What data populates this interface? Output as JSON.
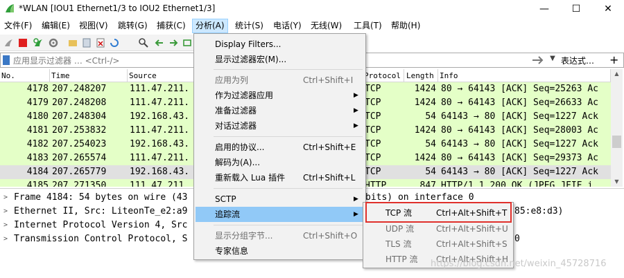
{
  "window": {
    "title": "*WLAN [IOU1 Ethernet1/3 to IOU2 Ethernet1/3]",
    "minimize": "—",
    "maximize": "☐",
    "close": "✕"
  },
  "menubar": [
    "文件(F)",
    "编辑(E)",
    "视图(V)",
    "跳转(G)",
    "捕获(C)",
    "分析(A)",
    "统计(S)",
    "电话(Y)",
    "无线(W)",
    "工具(T)",
    "帮助(H)"
  ],
  "filter": {
    "placeholder": "应用显示过滤器 … <Ctrl-/>",
    "expression_label": "表达式…",
    "add_label": "+",
    "dropdown": "▼"
  },
  "packet_list": {
    "columns": [
      "No.",
      "Time",
      "Source",
      "Protocol",
      "Length",
      "Info"
    ],
    "rows": [
      {
        "no": "4178",
        "time": "207.248207",
        "src": "111.47.211.",
        "proto": "TCP",
        "len": "1424",
        "info": "80 → 64143 [ACK] Seq=25263 Ac"
      },
      {
        "no": "4179",
        "time": "207.248208",
        "src": "111.47.211.",
        "proto": "TCP",
        "len": "1424",
        "info": "80 → 64143 [ACK] Seq=26633 Ac"
      },
      {
        "no": "4180",
        "time": "207.248304",
        "src": "192.168.43.",
        "proto": "TCP",
        "len": "54",
        "info": "64143 → 80 [ACK] Seq=1227 Ack"
      },
      {
        "no": "4181",
        "time": "207.253832",
        "src": "111.47.211.",
        "proto": "TCP",
        "len": "1424",
        "info": "80 → 64143 [ACK] Seq=28003 Ac"
      },
      {
        "no": "4182",
        "time": "207.254023",
        "src": "192.168.43.",
        "proto": "TCP",
        "len": "54",
        "info": "64143 → 80 [ACK] Seq=1227 Ack"
      },
      {
        "no": "4183",
        "time": "207.265574",
        "src": "111.47.211.",
        "proto": "TCP",
        "len": "1424",
        "info": "80 → 64143 [ACK] Seq=29373 Ac"
      },
      {
        "no": "4184",
        "time": "207.265779",
        "src": "192.168.43.",
        "proto": "TCP",
        "len": "54",
        "info": "64143 → 80 [ACK] Seq=1227 Ack"
      },
      {
        "no": "4185",
        "time": "207.271350",
        "src": "111.47.211.",
        "proto": "HTTP",
        "len": "847",
        "info": "HTTP/1.1 200 OK  (JPEG JFIF i"
      }
    ]
  },
  "details": [
    {
      "text": "Frame 4184: 54 bytes on wire (43",
      "tail": "bits) on interface 0"
    },
    {
      "text": "Ethernet II, Src: LiteonTe_e2:a9",
      "tail": "85:e8:d3)"
    },
    {
      "text": "Internet Protocol Version 4, Src",
      "tail": ""
    },
    {
      "text": "Transmission Control Protocol, S",
      "tail": "0"
    }
  ],
  "analyze_menu": {
    "items": [
      {
        "label": "Display Filters...",
        "shortcut": "",
        "arrow": false,
        "disabled": false
      },
      {
        "label": "显示过滤器宏(M)...",
        "shortcut": "",
        "arrow": false,
        "disabled": false
      },
      {
        "label": "应用为列",
        "shortcut": "Ctrl+Shift+I",
        "arrow": false,
        "disabled": true
      },
      {
        "label": "作为过滤器应用",
        "shortcut": "",
        "arrow": true,
        "disabled": false
      },
      {
        "label": "准备过滤器",
        "shortcut": "",
        "arrow": true,
        "disabled": false
      },
      {
        "label": "对话过滤器",
        "shortcut": "",
        "arrow": true,
        "disabled": false
      },
      {
        "label": "启用的协议...",
        "shortcut": "Ctrl+Shift+E",
        "arrow": false,
        "disabled": false
      },
      {
        "label": "解码为(A)...",
        "shortcut": "",
        "arrow": false,
        "disabled": false
      },
      {
        "label": "重新载入 Lua 插件",
        "shortcut": "Ctrl+Shift+L",
        "arrow": false,
        "disabled": false
      },
      {
        "label": "SCTP",
        "shortcut": "",
        "arrow": true,
        "disabled": false
      },
      {
        "label": "追踪流",
        "shortcut": "",
        "arrow": true,
        "disabled": false
      },
      {
        "label": "显示分组字节...",
        "shortcut": "Ctrl+Shift+O",
        "arrow": false,
        "disabled": true
      },
      {
        "label": "专家信息",
        "shortcut": "",
        "arrow": false,
        "disabled": false
      }
    ]
  },
  "follow_submenu": {
    "items": [
      {
        "label": "TCP 流",
        "shortcut": "Ctrl+Alt+Shift+T",
        "disabled": false
      },
      {
        "label": "UDP 流",
        "shortcut": "Ctrl+Alt+Shift+U",
        "disabled": true
      },
      {
        "label": "TLS 流",
        "shortcut": "Ctrl+Alt+Shift+S",
        "disabled": true
      },
      {
        "label": "HTTP 流",
        "shortcut": "Ctrl+Alt+Shift+H",
        "disabled": true
      }
    ]
  },
  "watermark": "https://blog.csdn.net/weixin_45728716",
  "colors": {
    "row_tcp": "#e4ffc7",
    "row_selected": "#e0e0e0",
    "menu_highlight": "#91c9f7",
    "red_box": "#e0302b"
  }
}
